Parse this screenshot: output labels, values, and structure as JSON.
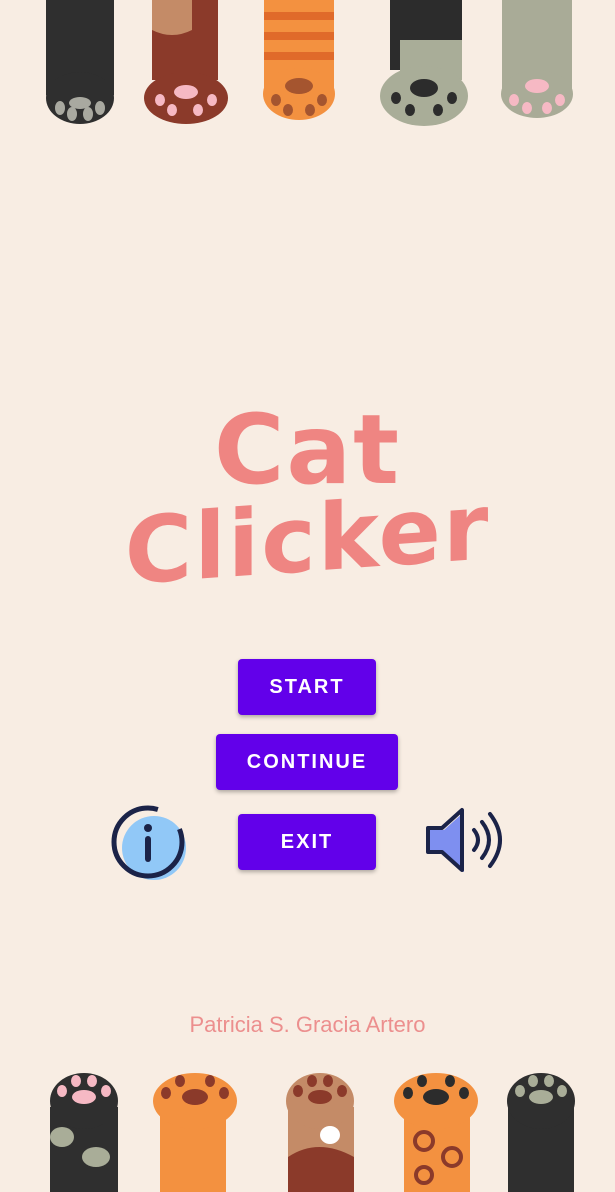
{
  "title": {
    "line1": "Cat",
    "line2": "Clicker"
  },
  "menu": {
    "start_label": "START",
    "continue_label": "CONTINUE",
    "exit_label": "EXIT"
  },
  "icons": {
    "info": "info-icon",
    "sound": "speaker-volume-icon"
  },
  "author": "Patricia S. Gracia Artero",
  "colors": {
    "background": "#f8ede3",
    "accent": "#6200ea",
    "title": "#ef8582",
    "author": "#ec8f8e"
  }
}
